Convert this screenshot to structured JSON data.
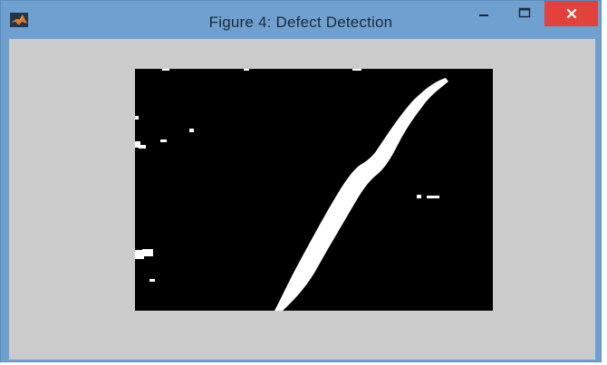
{
  "window": {
    "title": "Figure 4: Defect Detection",
    "controls": {
      "minimize": "minimize-icon",
      "maximize": "maximize-icon",
      "close": "close-icon"
    }
  },
  "figure": {
    "image": "binary-defect-mask",
    "background_color": "#000000",
    "foreground_color": "#ffffff"
  },
  "colors": {
    "titlebar": "#6fa0cf",
    "client_area": "#cbcbcb",
    "close_button": "#e3413b"
  }
}
